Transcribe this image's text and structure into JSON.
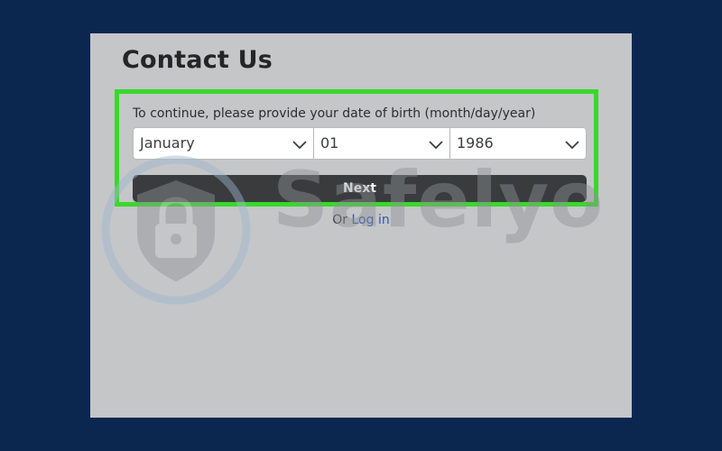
{
  "page": {
    "title": "Contact Us",
    "prompt": "To continue, please provide your date of birth (month/day/year)"
  },
  "birthdate": {
    "month": "January",
    "day": "01",
    "year": "1986"
  },
  "actions": {
    "next_label": "Next",
    "or_text": "Or",
    "login_label": "Log in"
  },
  "watermark": {
    "text": "Safelyo"
  },
  "colors": {
    "background": "#0b2750",
    "panel": "#c5c6c8",
    "highlight": "#39d82a",
    "button": "#393b3d",
    "link": "#3154b8"
  },
  "icons": [
    "chevron-down-icon",
    "shield-lock-icon"
  ]
}
